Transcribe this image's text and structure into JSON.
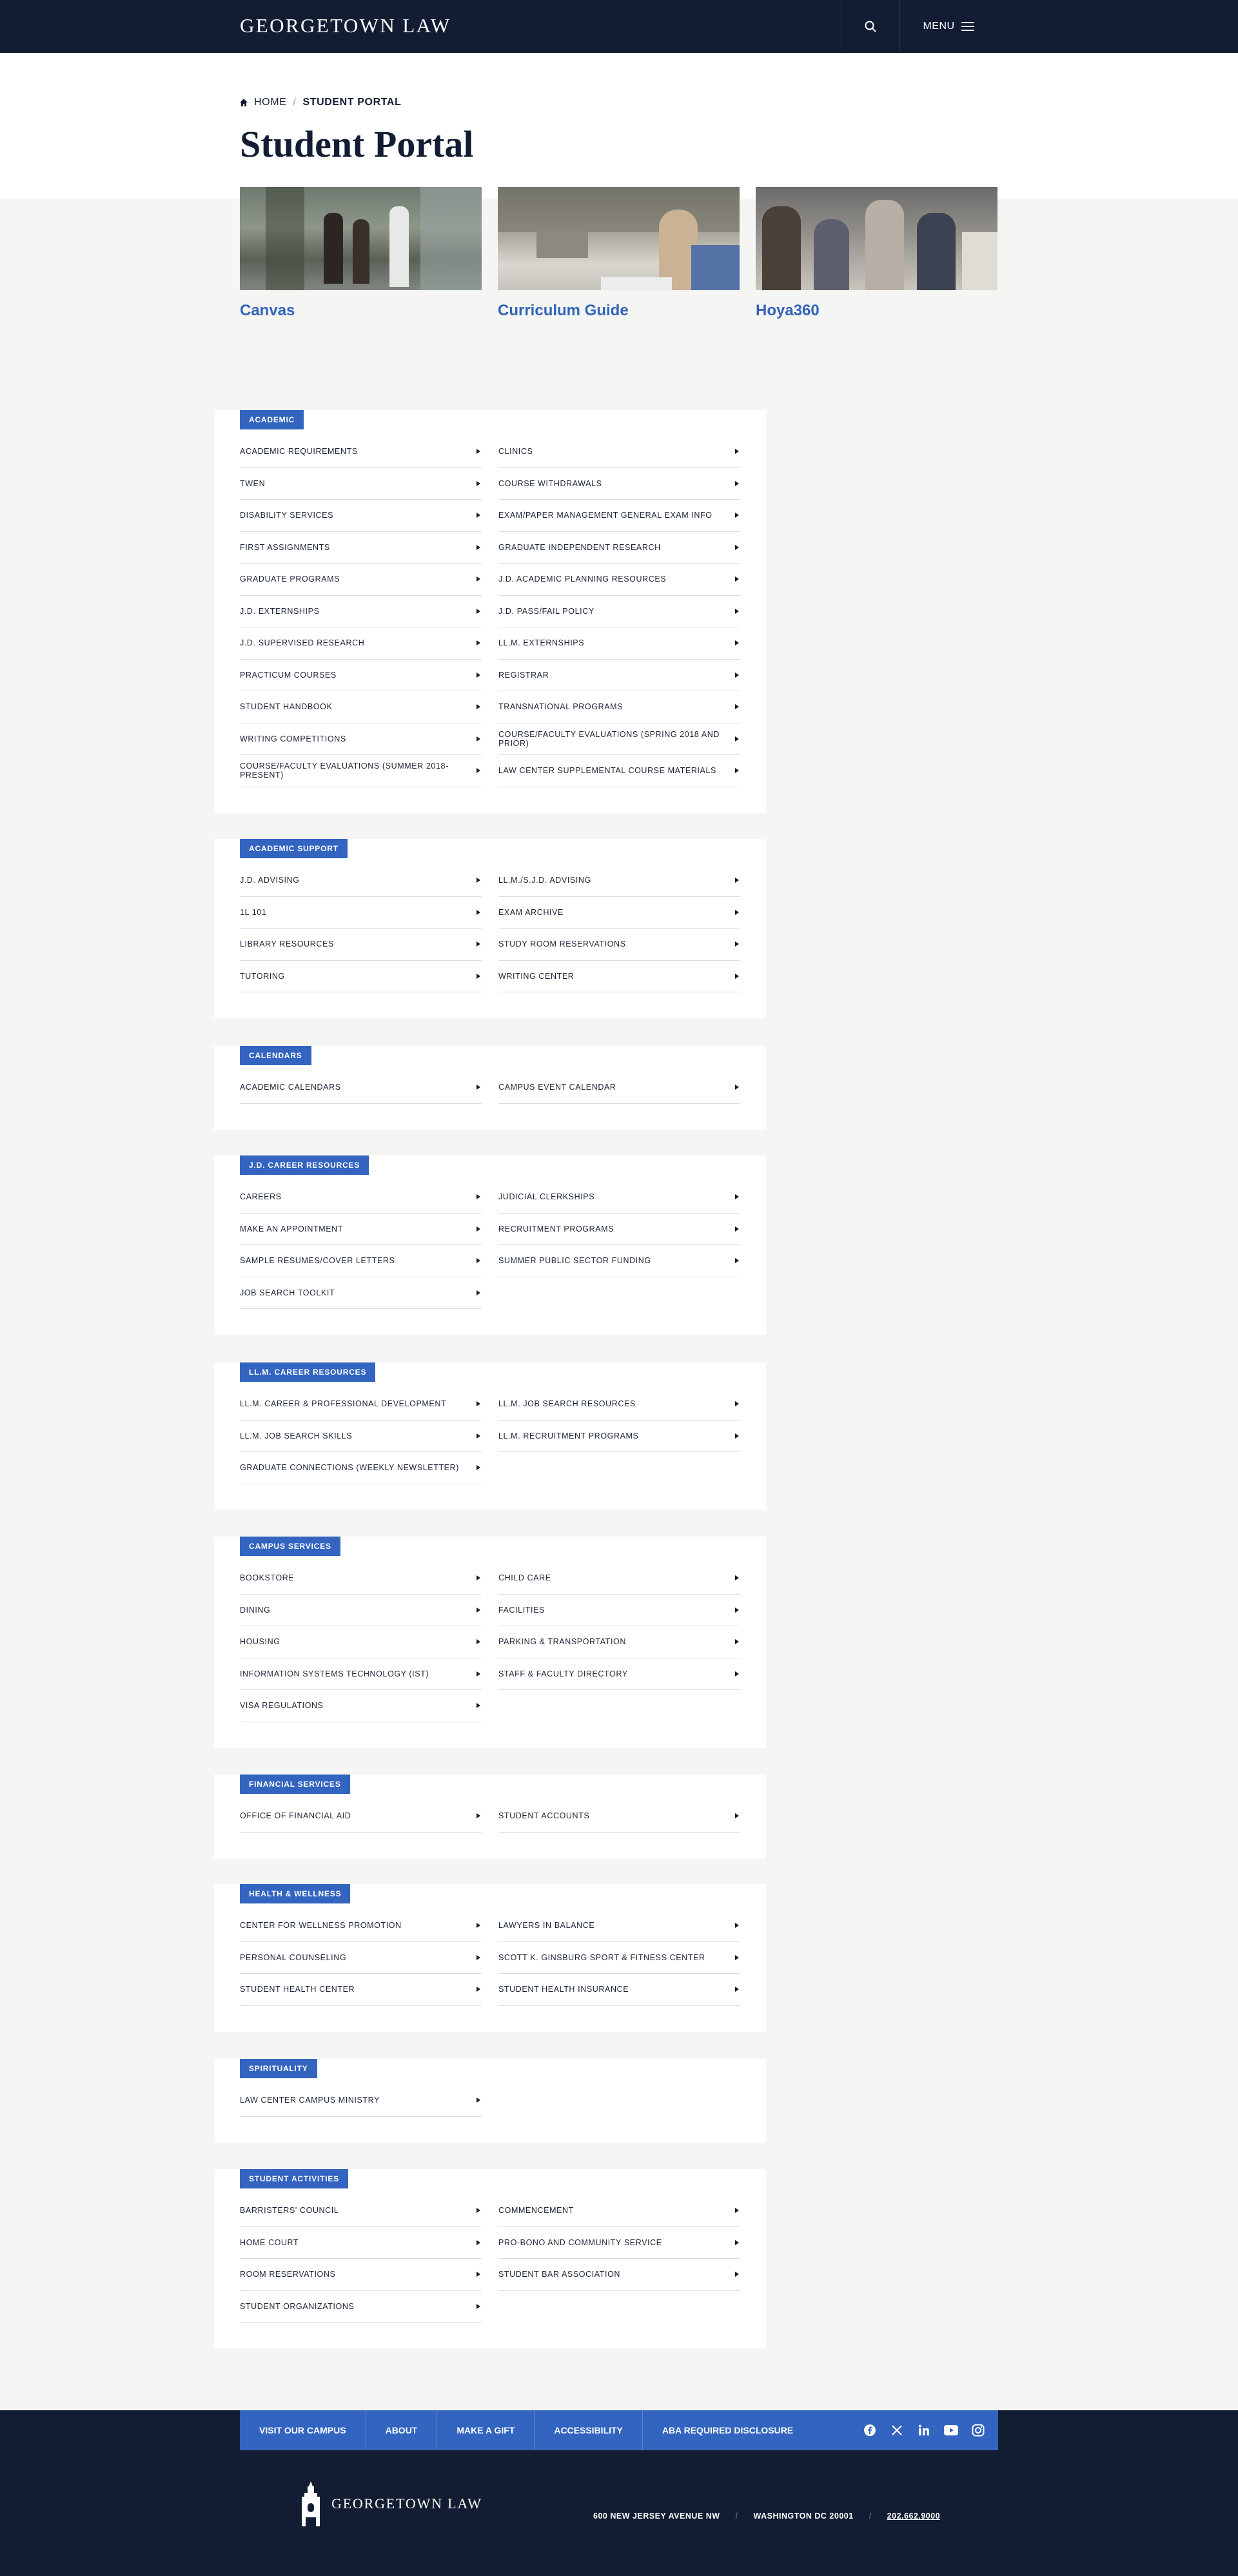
{
  "header": {
    "logo": "GEORGETOWN LAW",
    "menu_label": "MENU"
  },
  "breadcrumb": {
    "home": "HOME",
    "separator": "/",
    "current": "STUDENT PORTAL"
  },
  "page_title": "Student Portal",
  "features": [
    {
      "label": "Canvas"
    },
    {
      "label": "Curriculum Guide"
    },
    {
      "label": "Hoya360"
    }
  ],
  "sections": [
    {
      "title": "ACADEMIC",
      "links": [
        "ACADEMIC REQUIREMENTS",
        "CLINICS",
        "TWEN",
        "COURSE WITHDRAWALS",
        "DISABILITY SERVICES",
        "EXAM/PAPER MANAGEMENT GENERAL EXAM INFO",
        "FIRST ASSIGNMENTS",
        "GRADUATE INDEPENDENT RESEARCH",
        "GRADUATE PROGRAMS",
        "J.D. ACADEMIC PLANNING RESOURCES",
        "J.D. EXTERNSHIPS",
        "J.D. PASS/FAIL POLICY",
        "J.D. SUPERVISED RESEARCH",
        "LL.M. EXTERNSHIPS",
        "PRACTICUM COURSES",
        "REGISTRAR",
        "STUDENT HANDBOOK",
        "TRANSNATIONAL PROGRAMS",
        "WRITING COMPETITIONS",
        "COURSE/FACULTY EVALUATIONS (SPRING 2018 AND PRIOR)",
        "COURSE/FACULTY EVALUATIONS (SUMMER 2018-PRESENT)",
        "LAW CENTER SUPPLEMENTAL COURSE MATERIALS"
      ]
    },
    {
      "title": "ACADEMIC SUPPORT",
      "links": [
        "J.D. ADVISING",
        "LL.M./S.J.D. ADVISING",
        "1L 101",
        "EXAM ARCHIVE",
        "LIBRARY RESOURCES",
        "STUDY ROOM RESERVATIONS",
        "TUTORING",
        "WRITING CENTER"
      ]
    },
    {
      "title": "CALENDARS",
      "links": [
        "ACADEMIC CALENDARS",
        "CAMPUS EVENT CALENDAR"
      ]
    },
    {
      "title": "J.D. CAREER RESOURCES",
      "links": [
        "CAREERS",
        "JUDICIAL CLERKSHIPS",
        "MAKE AN APPOINTMENT",
        "RECRUITMENT PROGRAMS",
        "SAMPLE RESUMES/COVER LETTERS",
        "SUMMER PUBLIC SECTOR FUNDING",
        "JOB SEARCH TOOLKIT"
      ]
    },
    {
      "title": "LL.M. CAREER RESOURCES",
      "links": [
        "LL.M. CAREER & PROFESSIONAL DEVELOPMENT",
        "LL.M. JOB SEARCH RESOURCES",
        "LL.M. JOB SEARCH SKILLS",
        "LL.M. RECRUITMENT PROGRAMS",
        "GRADUATE CONNECTIONS (WEEKLY NEWSLETTER)"
      ]
    },
    {
      "title": "CAMPUS SERVICES",
      "links": [
        "BOOKSTORE",
        "CHILD CARE",
        "DINING",
        "FACILITIES",
        "HOUSING",
        "PARKING & TRANSPORTATION",
        "INFORMATION SYSTEMS TECHNOLOGY (IST)",
        "STAFF & FACULTY DIRECTORY",
        "VISA REGULATIONS"
      ]
    },
    {
      "title": "FINANCIAL SERVICES",
      "links": [
        "OFFICE OF FINANCIAL AID",
        "STUDENT ACCOUNTS"
      ]
    },
    {
      "title": "HEALTH & WELLNESS",
      "links": [
        "CENTER FOR WELLNESS PROMOTION",
        "LAWYERS IN BALANCE",
        "PERSONAL COUNSELING",
        "SCOTT K. GINSBURG SPORT & FITNESS CENTER",
        "STUDENT HEALTH CENTER",
        "STUDENT HEALTH INSURANCE"
      ]
    },
    {
      "title": "SPIRITUALITY",
      "links": [
        "LAW CENTER CAMPUS MINISTRY"
      ]
    },
    {
      "title": "STUDENT ACTIVITIES",
      "links": [
        "BARRISTERS' COUNCIL",
        "COMMENCEMENT",
        "HOME COURT",
        "PRO-BONO AND COMMUNITY SERVICE",
        "ROOM RESERVATIONS",
        "STUDENT BAR ASSOCIATION",
        "STUDENT ORGANIZATIONS"
      ]
    }
  ],
  "footer": {
    "nav": [
      "VISIT OUR CAMPUS",
      "ABOUT",
      "MAKE A GIFT",
      "ACCESSIBILITY",
      "ABA REQUIRED DISCLOSURE"
    ],
    "logo": "GEORGETOWN LAW",
    "address": "600 NEW JERSEY AVENUE NW",
    "city": "WASHINGTON DC 20001",
    "phone": "202.662.9000"
  },
  "colors": {
    "navy": "#121d33",
    "accent_blue": "#3264c0"
  }
}
